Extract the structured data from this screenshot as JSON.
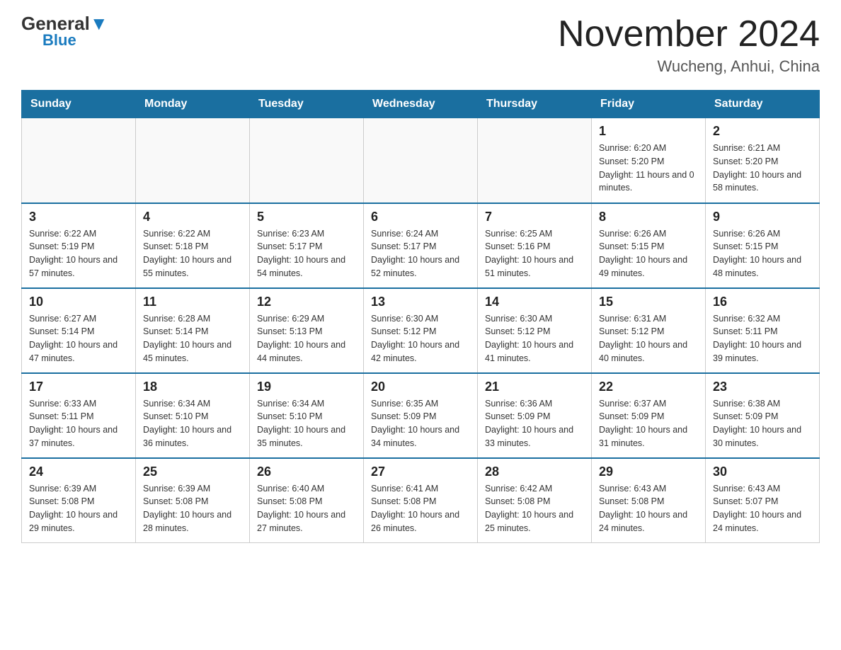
{
  "header": {
    "logo": {
      "general": "General",
      "blue": "Blue"
    },
    "title": "November 2024",
    "location": "Wucheng, Anhui, China"
  },
  "days_of_week": [
    "Sunday",
    "Monday",
    "Tuesday",
    "Wednesday",
    "Thursday",
    "Friday",
    "Saturday"
  ],
  "weeks": [
    [
      {
        "day": "",
        "info": ""
      },
      {
        "day": "",
        "info": ""
      },
      {
        "day": "",
        "info": ""
      },
      {
        "day": "",
        "info": ""
      },
      {
        "day": "",
        "info": ""
      },
      {
        "day": "1",
        "info": "Sunrise: 6:20 AM\nSunset: 5:20 PM\nDaylight: 11 hours and 0 minutes."
      },
      {
        "day": "2",
        "info": "Sunrise: 6:21 AM\nSunset: 5:20 PM\nDaylight: 10 hours and 58 minutes."
      }
    ],
    [
      {
        "day": "3",
        "info": "Sunrise: 6:22 AM\nSunset: 5:19 PM\nDaylight: 10 hours and 57 minutes."
      },
      {
        "day": "4",
        "info": "Sunrise: 6:22 AM\nSunset: 5:18 PM\nDaylight: 10 hours and 55 minutes."
      },
      {
        "day": "5",
        "info": "Sunrise: 6:23 AM\nSunset: 5:17 PM\nDaylight: 10 hours and 54 minutes."
      },
      {
        "day": "6",
        "info": "Sunrise: 6:24 AM\nSunset: 5:17 PM\nDaylight: 10 hours and 52 minutes."
      },
      {
        "day": "7",
        "info": "Sunrise: 6:25 AM\nSunset: 5:16 PM\nDaylight: 10 hours and 51 minutes."
      },
      {
        "day": "8",
        "info": "Sunrise: 6:26 AM\nSunset: 5:15 PM\nDaylight: 10 hours and 49 minutes."
      },
      {
        "day": "9",
        "info": "Sunrise: 6:26 AM\nSunset: 5:15 PM\nDaylight: 10 hours and 48 minutes."
      }
    ],
    [
      {
        "day": "10",
        "info": "Sunrise: 6:27 AM\nSunset: 5:14 PM\nDaylight: 10 hours and 47 minutes."
      },
      {
        "day": "11",
        "info": "Sunrise: 6:28 AM\nSunset: 5:14 PM\nDaylight: 10 hours and 45 minutes."
      },
      {
        "day": "12",
        "info": "Sunrise: 6:29 AM\nSunset: 5:13 PM\nDaylight: 10 hours and 44 minutes."
      },
      {
        "day": "13",
        "info": "Sunrise: 6:30 AM\nSunset: 5:12 PM\nDaylight: 10 hours and 42 minutes."
      },
      {
        "day": "14",
        "info": "Sunrise: 6:30 AM\nSunset: 5:12 PM\nDaylight: 10 hours and 41 minutes."
      },
      {
        "day": "15",
        "info": "Sunrise: 6:31 AM\nSunset: 5:12 PM\nDaylight: 10 hours and 40 minutes."
      },
      {
        "day": "16",
        "info": "Sunrise: 6:32 AM\nSunset: 5:11 PM\nDaylight: 10 hours and 39 minutes."
      }
    ],
    [
      {
        "day": "17",
        "info": "Sunrise: 6:33 AM\nSunset: 5:11 PM\nDaylight: 10 hours and 37 minutes."
      },
      {
        "day": "18",
        "info": "Sunrise: 6:34 AM\nSunset: 5:10 PM\nDaylight: 10 hours and 36 minutes."
      },
      {
        "day": "19",
        "info": "Sunrise: 6:34 AM\nSunset: 5:10 PM\nDaylight: 10 hours and 35 minutes."
      },
      {
        "day": "20",
        "info": "Sunrise: 6:35 AM\nSunset: 5:09 PM\nDaylight: 10 hours and 34 minutes."
      },
      {
        "day": "21",
        "info": "Sunrise: 6:36 AM\nSunset: 5:09 PM\nDaylight: 10 hours and 33 minutes."
      },
      {
        "day": "22",
        "info": "Sunrise: 6:37 AM\nSunset: 5:09 PM\nDaylight: 10 hours and 31 minutes."
      },
      {
        "day": "23",
        "info": "Sunrise: 6:38 AM\nSunset: 5:09 PM\nDaylight: 10 hours and 30 minutes."
      }
    ],
    [
      {
        "day": "24",
        "info": "Sunrise: 6:39 AM\nSunset: 5:08 PM\nDaylight: 10 hours and 29 minutes."
      },
      {
        "day": "25",
        "info": "Sunrise: 6:39 AM\nSunset: 5:08 PM\nDaylight: 10 hours and 28 minutes."
      },
      {
        "day": "26",
        "info": "Sunrise: 6:40 AM\nSunset: 5:08 PM\nDaylight: 10 hours and 27 minutes."
      },
      {
        "day": "27",
        "info": "Sunrise: 6:41 AM\nSunset: 5:08 PM\nDaylight: 10 hours and 26 minutes."
      },
      {
        "day": "28",
        "info": "Sunrise: 6:42 AM\nSunset: 5:08 PM\nDaylight: 10 hours and 25 minutes."
      },
      {
        "day": "29",
        "info": "Sunrise: 6:43 AM\nSunset: 5:08 PM\nDaylight: 10 hours and 24 minutes."
      },
      {
        "day": "30",
        "info": "Sunrise: 6:43 AM\nSunset: 5:07 PM\nDaylight: 10 hours and 24 minutes."
      }
    ]
  ]
}
